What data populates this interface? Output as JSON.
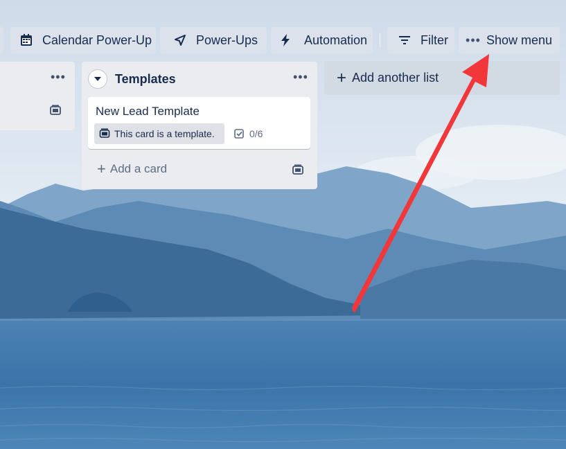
{
  "toolbar": {
    "calendar_label": "Calendar Power-Up",
    "powerups_label": "Power-Ups",
    "automation_label": "Automation",
    "filter_label": "Filter",
    "show_menu_label": "Show menu"
  },
  "lists": {
    "templates": {
      "title": "Templates",
      "card": {
        "title": "New Lead Template",
        "template_badge": "This card is a template.",
        "checklist": "0/6"
      },
      "add_card_label": "Add a card"
    }
  },
  "add_list_label": "Add another list",
  "colors": {
    "sky": "#dbe6f2",
    "mountains": "#3f6f9e",
    "water": "#3b79ad",
    "arrow": "#f2373a",
    "list_bg": "#ebecf0",
    "badge_bg": "#dfe1e6"
  },
  "icons": [
    "calendar-icon",
    "rocket-icon",
    "bolt-icon",
    "filter-icon",
    "more-icon",
    "template-icon",
    "checklist-icon",
    "plus-icon",
    "chevron-down-icon"
  ]
}
